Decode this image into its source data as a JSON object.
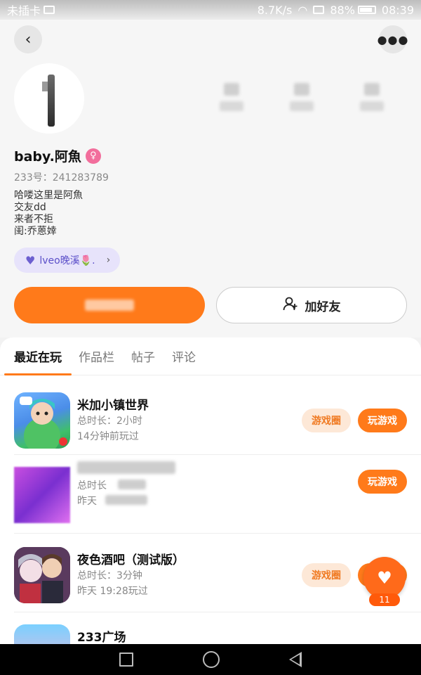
{
  "status_bar": {
    "carrier": "未插卡",
    "speed": "8.7K/s",
    "battery": "88%",
    "time": "08:39"
  },
  "header": {
    "back_icon": "chevron-left-icon",
    "more_icon": "more-icon",
    "nickname": "baby.阿魚",
    "gender_icon": "female-icon",
    "uid_label": "233号：",
    "uid": "241283789",
    "bio_lines": [
      "哈喽这里是阿魚",
      "交友dd",
      "来者不拒",
      "闺:乔蒽婞"
    ],
    "partner_tag": "lveo晚溪🌷.",
    "add_friend_label": "加好友"
  },
  "tabs": [
    "最近在玩",
    "作品栏",
    "帖子",
    "评论"
  ],
  "games": [
    {
      "title": "米加小镇世界",
      "duration": "总时长：2小时",
      "last_played": "14分钟前玩过",
      "circle": "游戏圈",
      "play": "玩游戏"
    },
    {
      "title": "",
      "duration": "总时长",
      "last_played": "昨天",
      "circle": "",
      "play": "玩游戏"
    },
    {
      "title": "夜色酒吧（测试版）",
      "duration": "总时长：3分钟",
      "last_played": "昨天 19:28玩过",
      "circle": "游戏圈",
      "play": "玩游戏"
    },
    {
      "title": "233广场"
    }
  ],
  "fab": {
    "count": "11"
  },
  "colors": {
    "accent": "#ff7a1a",
    "circle_bg": "#fde8d7"
  }
}
